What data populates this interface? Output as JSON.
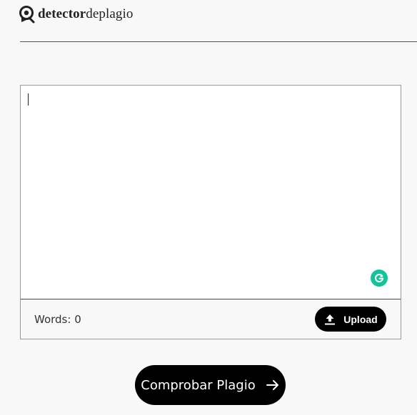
{
  "header": {
    "logo_bold": "detector",
    "logo_light": "deplagio",
    "logo_icon": "magnifier-logo-icon"
  },
  "editor": {
    "text_value": "",
    "word_count_label": "Words: 0",
    "grammarly_icon": "grammarly-icon",
    "upload_label": "Upload",
    "upload_icon": "upload-icon"
  },
  "actions": {
    "check_label": "Comprobar Plagio",
    "check_icon": "arrow-right-icon"
  },
  "colors": {
    "background": "#f8f8f8",
    "button": "#000000",
    "button_text": "#ffffff",
    "grammarly": "#15c39a",
    "divider": "#555555"
  }
}
